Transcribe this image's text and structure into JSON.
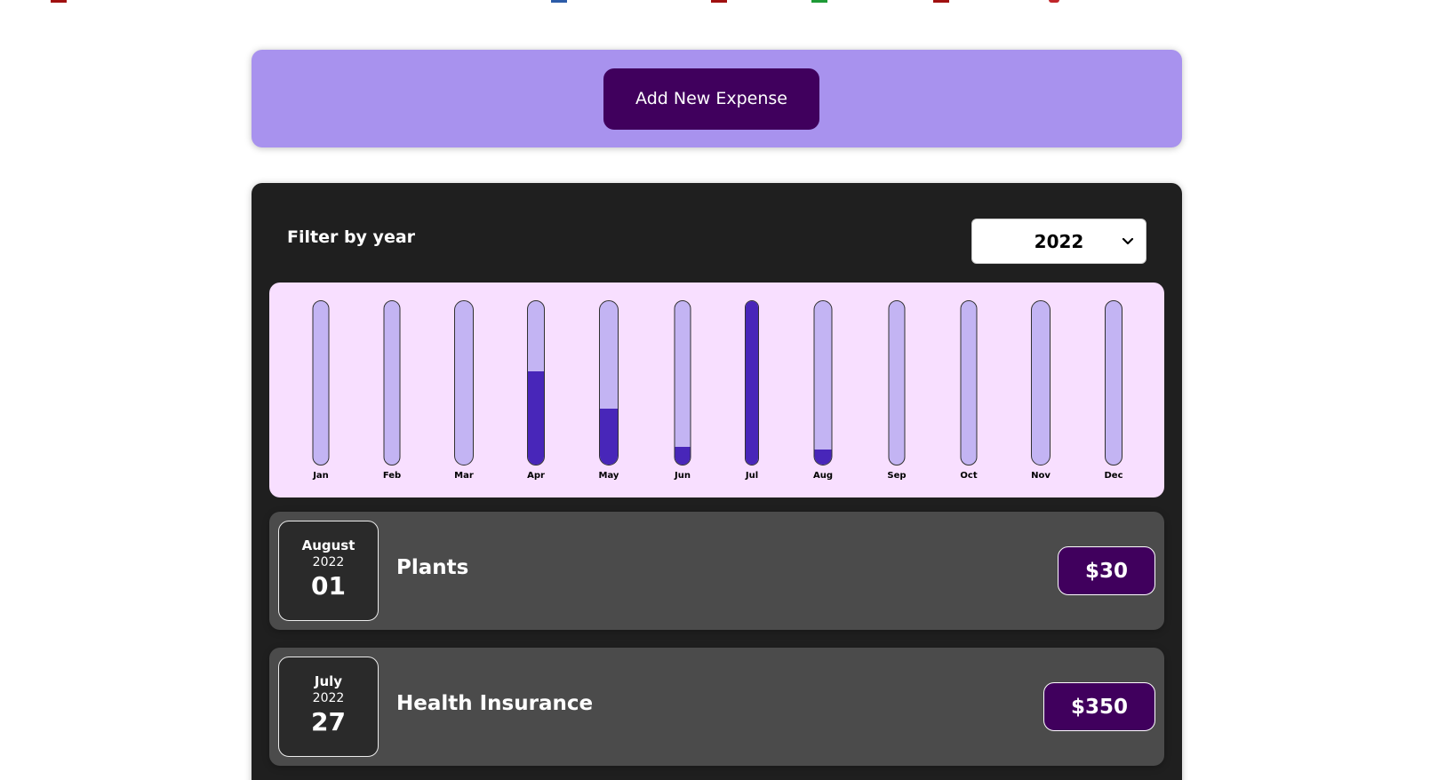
{
  "new_expense": {
    "add_button_label": "Add New Expense"
  },
  "filter": {
    "label": "Filter by year",
    "selected_year": "2022"
  },
  "chart_data": {
    "type": "bar",
    "categories": [
      "Jan",
      "Feb",
      "Mar",
      "Apr",
      "May",
      "Jun",
      "Jul",
      "Aug",
      "Sep",
      "Oct",
      "Nov",
      "Dec"
    ],
    "values": [
      0,
      0,
      0,
      0.57,
      0.34,
      0.11,
      1.0,
      0.09,
      0,
      0,
      0,
      0
    ],
    "ylim": [
      0,
      1
    ],
    "grid": false,
    "colors": {
      "track": "#c3b4f3",
      "fill": "#4826b9",
      "background": "#f8dfff"
    }
  },
  "expenses": [
    {
      "month": "August",
      "year": "2022",
      "day": "01",
      "title": "Plants",
      "amount": "$30"
    },
    {
      "month": "July",
      "year": "2022",
      "day": "27",
      "title": "Health Insurance",
      "amount": "$350"
    }
  ],
  "colors": {
    "accent": "#40005d",
    "new_expense_bg": "#a892ee",
    "panel_bg": "#1f1f1f",
    "item_bg": "#4b4b4b"
  },
  "icons": {
    "select_chevron": "chevron-down-icon"
  }
}
